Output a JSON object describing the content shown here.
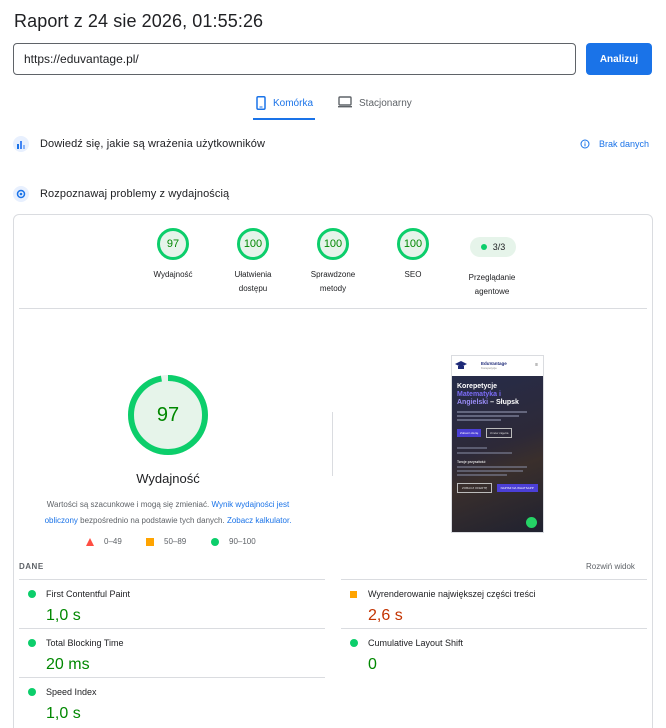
{
  "header": {
    "title": "Raport z 24 sie 2026, 01:55:26"
  },
  "search": {
    "url": "https://eduvantage.pl/",
    "button_label": "Analizuj"
  },
  "tabs": [
    {
      "label": "Komórka",
      "active": true
    },
    {
      "label": "Stacjonarny",
      "active": false
    }
  ],
  "field_data": {
    "label": "Dowiedź się, jakie są wrażenia użytkowników",
    "no_data_label": "Brak danych"
  },
  "lab_data": {
    "label": "Rozpoznawaj problemy z wydajnością"
  },
  "categories": [
    {
      "score": "97",
      "label_line1": "Wydajność",
      "label_line2": ""
    },
    {
      "score": "100",
      "label_line1": "Ułatwienia",
      "label_line2": "dostępu"
    },
    {
      "score": "100",
      "label_line1": "Sprawdzone",
      "label_line2": "metody"
    },
    {
      "score": "100",
      "label_line1": "SEO",
      "label_line2": ""
    }
  ],
  "agent": {
    "badge": "3/3",
    "label_line1": "Przeglądanie",
    "label_line2": "agentowe"
  },
  "performance": {
    "score": "97",
    "score_fraction": 0.97,
    "label": "Wydajność",
    "disclaimer_part1": "Wartości są szacunkowe i mogą się zmieniać.",
    "disclaimer_link1": "Wynik wydajności jest obliczony",
    "disclaimer_part2": "bezpośrednio na podstawie tych danych.",
    "disclaimer_link2": "Zobacz kalkulator."
  },
  "legend": [
    {
      "range": "0–49",
      "color": "#ff4e42"
    },
    {
      "range": "50–89",
      "color": "#ffa400"
    },
    {
      "range": "90–100",
      "color": "#0cce6b"
    }
  ],
  "screenshot": {
    "brand_line1": "EduVantage",
    "brand_line2": "Korepetycje",
    "headline1": "Korepetycje",
    "headline2": "Matematyka i",
    "headline3": "Angielski",
    "headline4": "– Słupsk",
    "cta1": "Zobacz ofertę",
    "cta2": "Umów zajęcia",
    "section": "Twoje przyszłość",
    "btn_a": "ZOBACZ OFERTĘ",
    "btn_b": "NAPISZ NA WHATSAPP"
  },
  "metrics": {
    "section_label": "DANE",
    "expand_label": "Rozwiń widok",
    "items": [
      {
        "name": "First Contentful Paint",
        "value": "1,0 s",
        "status": "good"
      },
      {
        "name": "Wyrenderowanie największej części treści",
        "value": "2,6 s",
        "status": "average"
      },
      {
        "name": "Total Blocking Time",
        "value": "20 ms",
        "status": "good"
      },
      {
        "name": "Cumulative Layout Shift",
        "value": "0",
        "status": "good"
      },
      {
        "name": "Speed Index",
        "value": "1,0 s",
        "status": "good"
      }
    ]
  },
  "colors": {
    "accent": "#1a73e8",
    "pass": "#0cce6b",
    "average": "#ffa400",
    "fail": "#ff4e42"
  }
}
